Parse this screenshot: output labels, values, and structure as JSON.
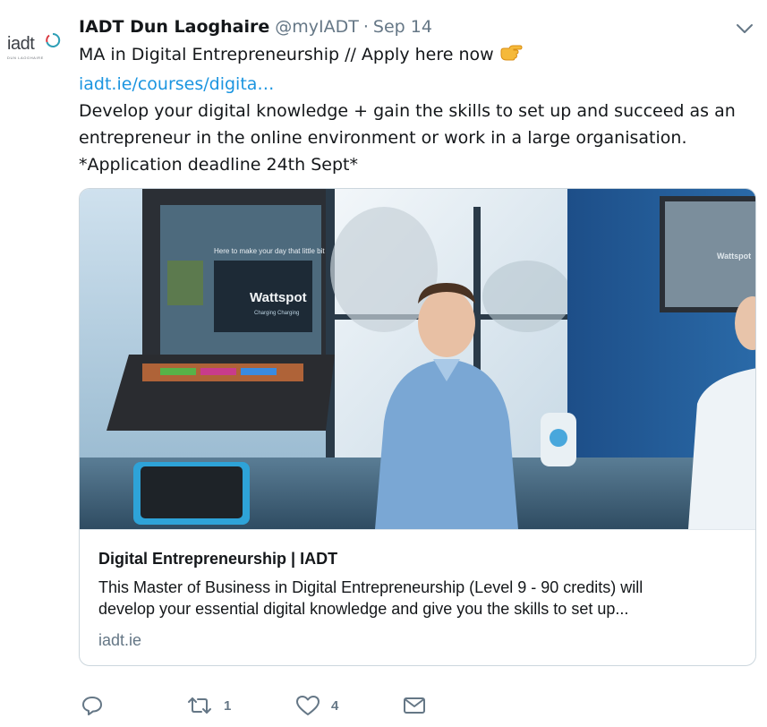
{
  "avatar": {
    "wordmark": "iadt",
    "subtext": "DUN LAOGHAIRE"
  },
  "tweet": {
    "author_name": "IADT Dun Laoghaire",
    "handle": "@myIADT",
    "separator": "·",
    "date": "Sep 14",
    "text_line1": "MA in Digital Entrepreneurship // Apply here now",
    "emoji": "pointing-right-hand-emoji",
    "link": "iadt.ie/courses/digita…",
    "text_line2": "Develop your digital knowledge + gain the skills to set up and succeed as an",
    "text_line3": "entrepreneur in the online environment or work in a large organisation.",
    "text_line4": "*Application deadline 24th Sept*"
  },
  "card": {
    "image_text_1": "Wattspot",
    "image_text_2": "Charging Charging",
    "image_text_3": "Here to make your day that little bit",
    "image_text_4": "Wattspot",
    "title": "Digital Entrepreneurship | IADT",
    "desc_line1": "This Master of Business in Digital Entrepreneurship (Level 9 - 90 credits) will",
    "desc_line2": "develop your essential digital knowledge and give you the skills to set up...",
    "domain": "iadt.ie"
  },
  "actions": {
    "reply_icon": "reply-icon",
    "retweet_icon": "retweet-icon",
    "retweet_count": "1",
    "like_icon": "heart-icon",
    "like_count": "4",
    "dm_icon": "envelope-icon"
  },
  "colors": {
    "link": "#1b95e0",
    "secondary_text": "#657786",
    "primary_text": "#14171a",
    "border": "#ccd6dd"
  }
}
